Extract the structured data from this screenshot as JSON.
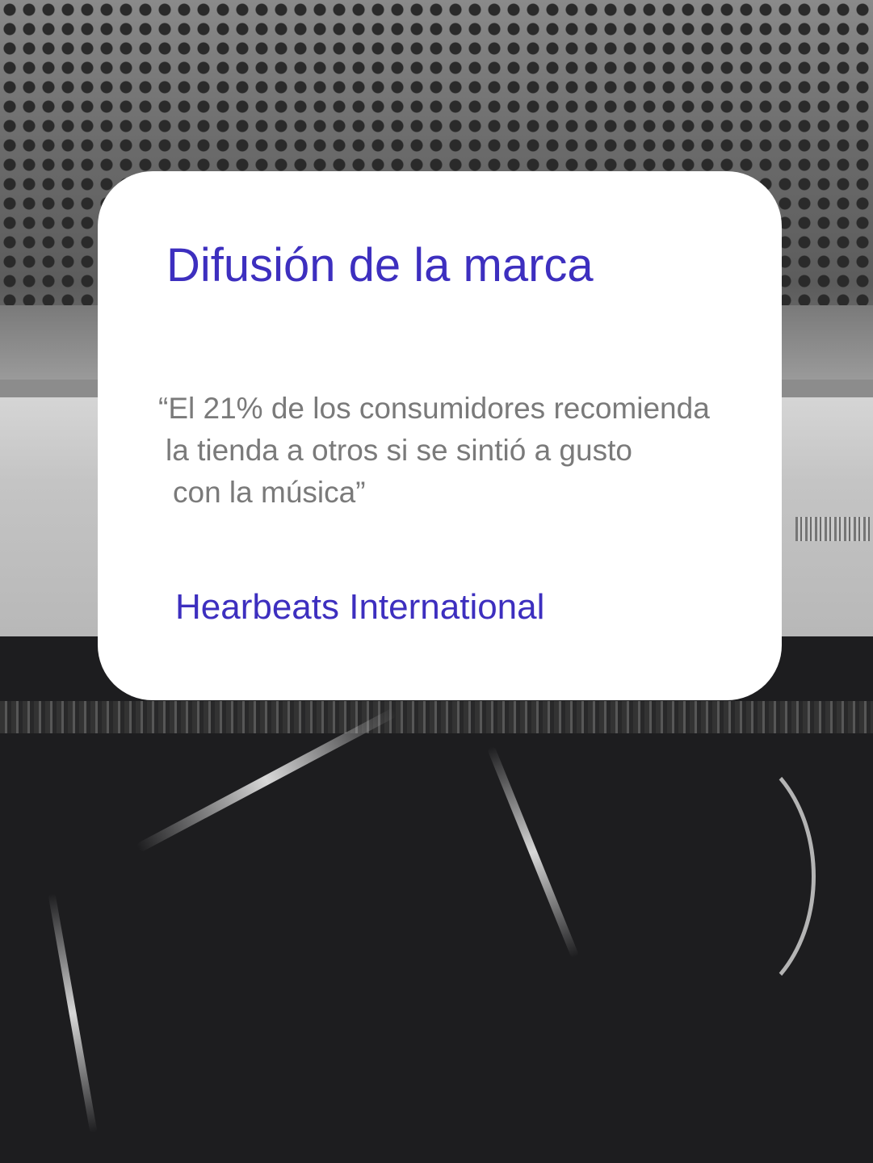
{
  "card": {
    "title": "Difusión de la marca",
    "quote_lines": [
      "“El 21% de los consumidores recomienda",
      "la tienda a otros si se sintió a gusto",
      "con la música”"
    ],
    "source": "Hearbeats International"
  },
  "colors": {
    "accent": "#3d2fbf",
    "quote_text": "#7a7a7a",
    "card_background": "#ffffff"
  }
}
